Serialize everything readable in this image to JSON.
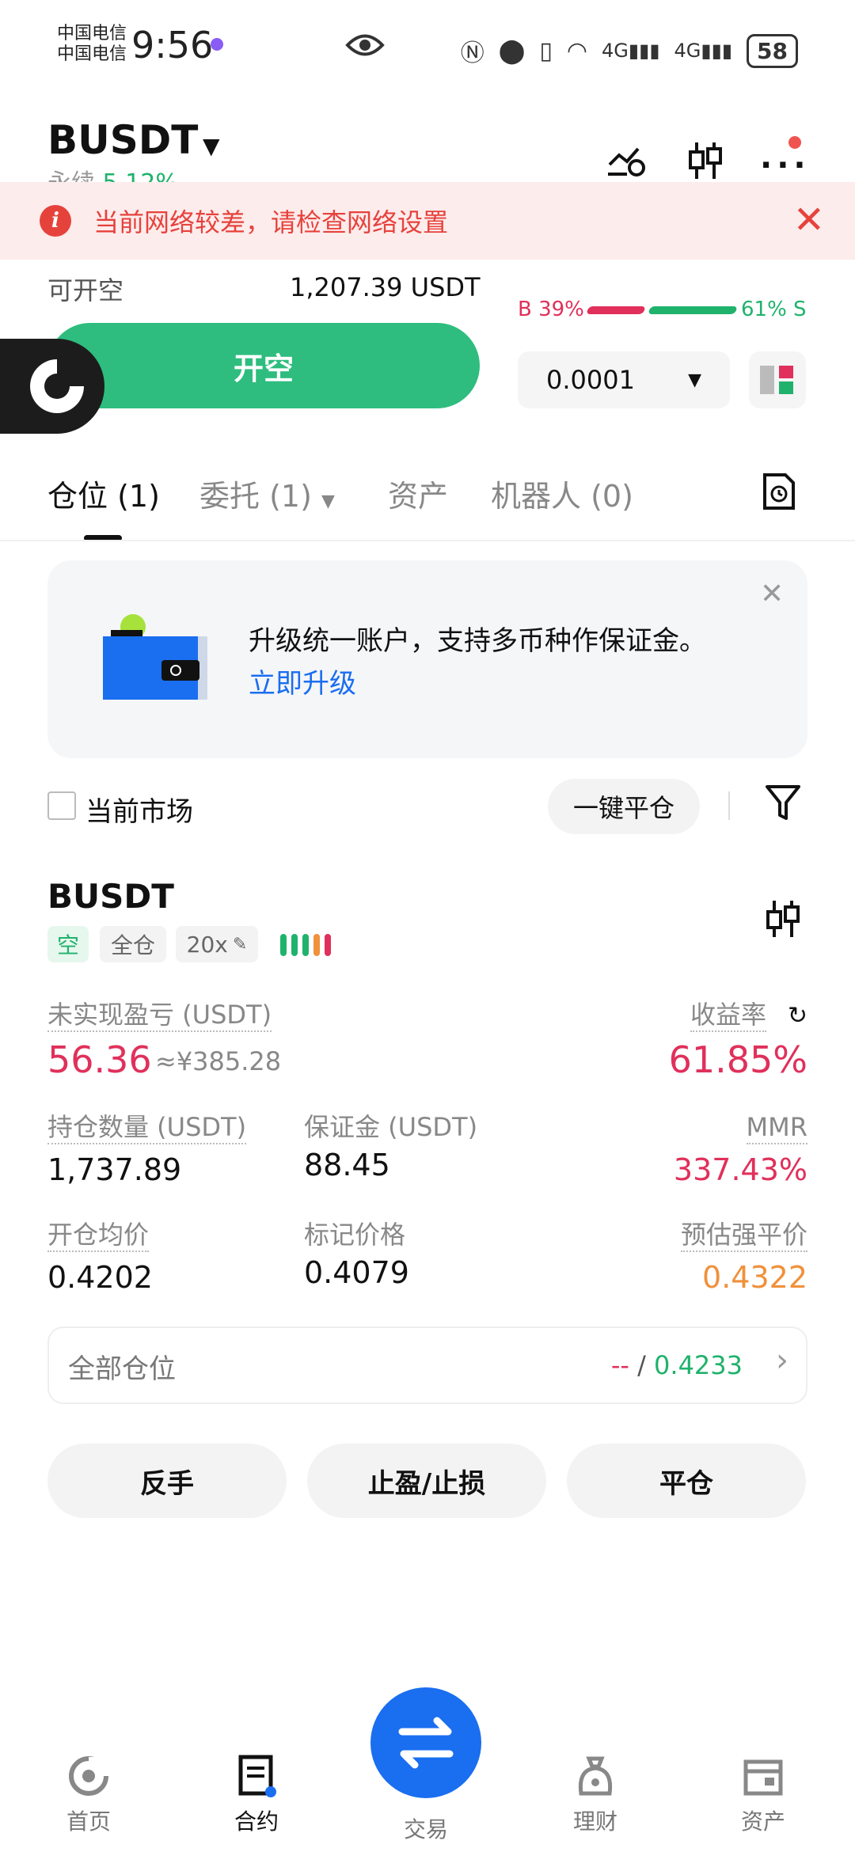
{
  "status_bar": {
    "carrier_1": "中国电信",
    "carrier_2": "中国电信",
    "time": "9:56",
    "network_1": "4G",
    "network_2": "4G",
    "battery": "58"
  },
  "header": {
    "pair": "BUSDT",
    "subtitle": "永续",
    "change": "5.12%"
  },
  "alert_banner": {
    "text": "当前网络较差，请检查网络设置"
  },
  "trade_panel": {
    "available_label": "可开空",
    "available_value": "1,207.39 USDT",
    "open_short_button": "开空",
    "buy_ratio": "B 39%",
    "sell_ratio": "61% S",
    "buy_ratio_value": 0.39,
    "precision_value": "0.0001"
  },
  "tabs": [
    {
      "label": "仓位 (1)"
    },
    {
      "label": "委托 (1)"
    },
    {
      "label": "资产"
    },
    {
      "label": "机器人 (0)"
    }
  ],
  "promo": {
    "text": "升级统一账户，支持多币种作保证金。",
    "link": "立即升级"
  },
  "filter": {
    "checkbox_label": "当前市场",
    "close_all_button": "一键平仓"
  },
  "position": {
    "name": "BUSDT",
    "tags": {
      "side": "空",
      "margin_mode": "全仓",
      "leverage": "20x"
    },
    "unrealized_pnl_label": "未实现盈亏 (USDT)",
    "unrealized_pnl_value": "56.36",
    "unrealized_pnl_cny": "≈¥385.28",
    "roe_label": "收益率",
    "roe_value": "61.85%",
    "size_label": "持仓数量 (USDT)",
    "size_value": "1,737.89",
    "margin_label": "保证金 (USDT)",
    "margin_value": "88.45",
    "mmr_label": "MMR",
    "mmr_value": "337.43%",
    "entry_label": "开仓均价",
    "entry_value": "0.4202",
    "mark_label": "标记价格",
    "mark_value": "0.4079",
    "liq_label": "预估强平价",
    "liq_value": "0.4322"
  },
  "all_positions": {
    "label": "全部仓位",
    "value_left": "--",
    "separator": "/",
    "value_right": "0.4233"
  },
  "actions": {
    "reverse": "反手",
    "tp_sl": "止盈/止损",
    "close": "平仓"
  },
  "bottom_nav": [
    {
      "label": "首页"
    },
    {
      "label": "合约"
    },
    {
      "label": "交易"
    },
    {
      "label": "理财"
    },
    {
      "label": "资产"
    }
  ],
  "colors": {
    "accent": "#1a6ef0",
    "sell_green": "#2ebd7e",
    "loss_red": "#e0305b",
    "warning": "#e6423c"
  }
}
